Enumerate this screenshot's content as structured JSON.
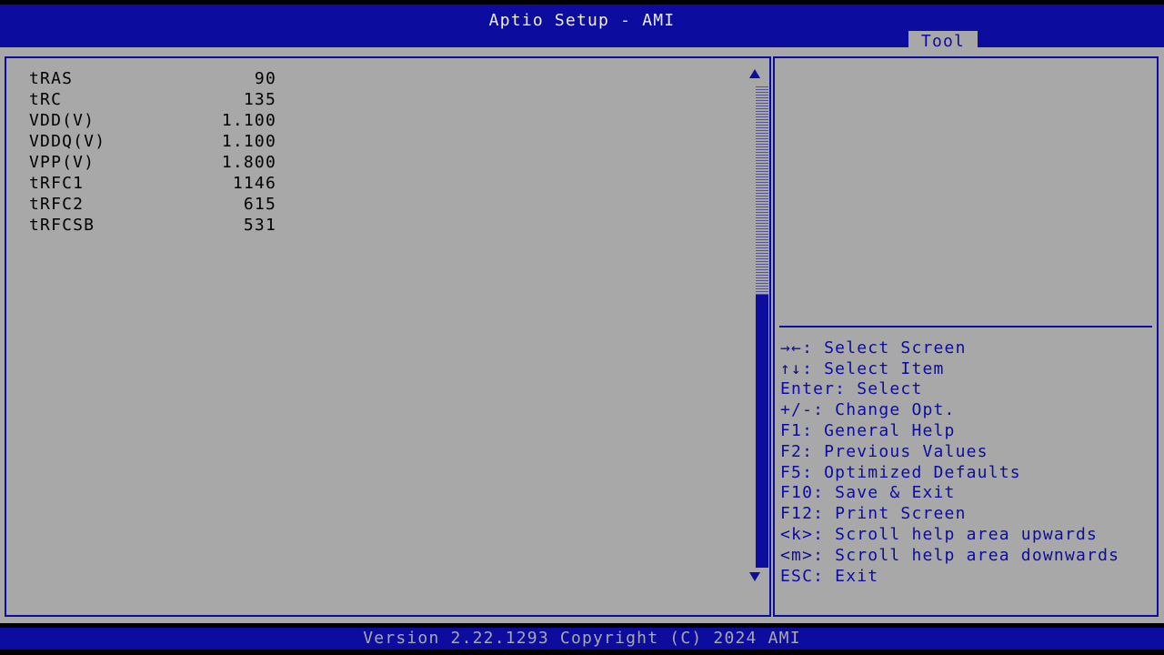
{
  "header": {
    "title": "Aptio Setup - AMI",
    "tab_label": "Tool"
  },
  "timings": [
    {
      "name": "tRAS",
      "value": "90"
    },
    {
      "name": "tRC",
      "value": "135"
    },
    {
      "name": "VDD(V)",
      "value": "1.100"
    },
    {
      "name": "VDDQ(V)",
      "value": "1.100"
    },
    {
      "name": "VPP(V)",
      "value": "1.800"
    },
    {
      "name": "tRFC1",
      "value": "1146"
    },
    {
      "name": "tRFC2",
      "value": "615"
    },
    {
      "name": "tRFCSB",
      "value": "531"
    }
  ],
  "help": {
    "lines": [
      "→←: Select Screen",
      "↑↓: Select Item",
      "Enter: Select",
      "+/-: Change Opt.",
      "F1: General Help",
      "F2: Previous Values",
      "F5: Optimized Defaults",
      "F10: Save & Exit",
      "F12: Print Screen",
      "<k>: Scroll help area upwards",
      "<m>: Scroll help area downwards",
      "ESC: Exit"
    ]
  },
  "footer": {
    "version": "Version 2.22.1293 Copyright (C) 2024 AMI"
  },
  "colors": {
    "bios_blue": "#0c0c9e",
    "panel_gray": "#a8a8a8",
    "title_text": "#f0f0f0"
  },
  "icons": {
    "scroll_up": "triangle-up-icon",
    "scroll_down": "triangle-down-icon"
  }
}
